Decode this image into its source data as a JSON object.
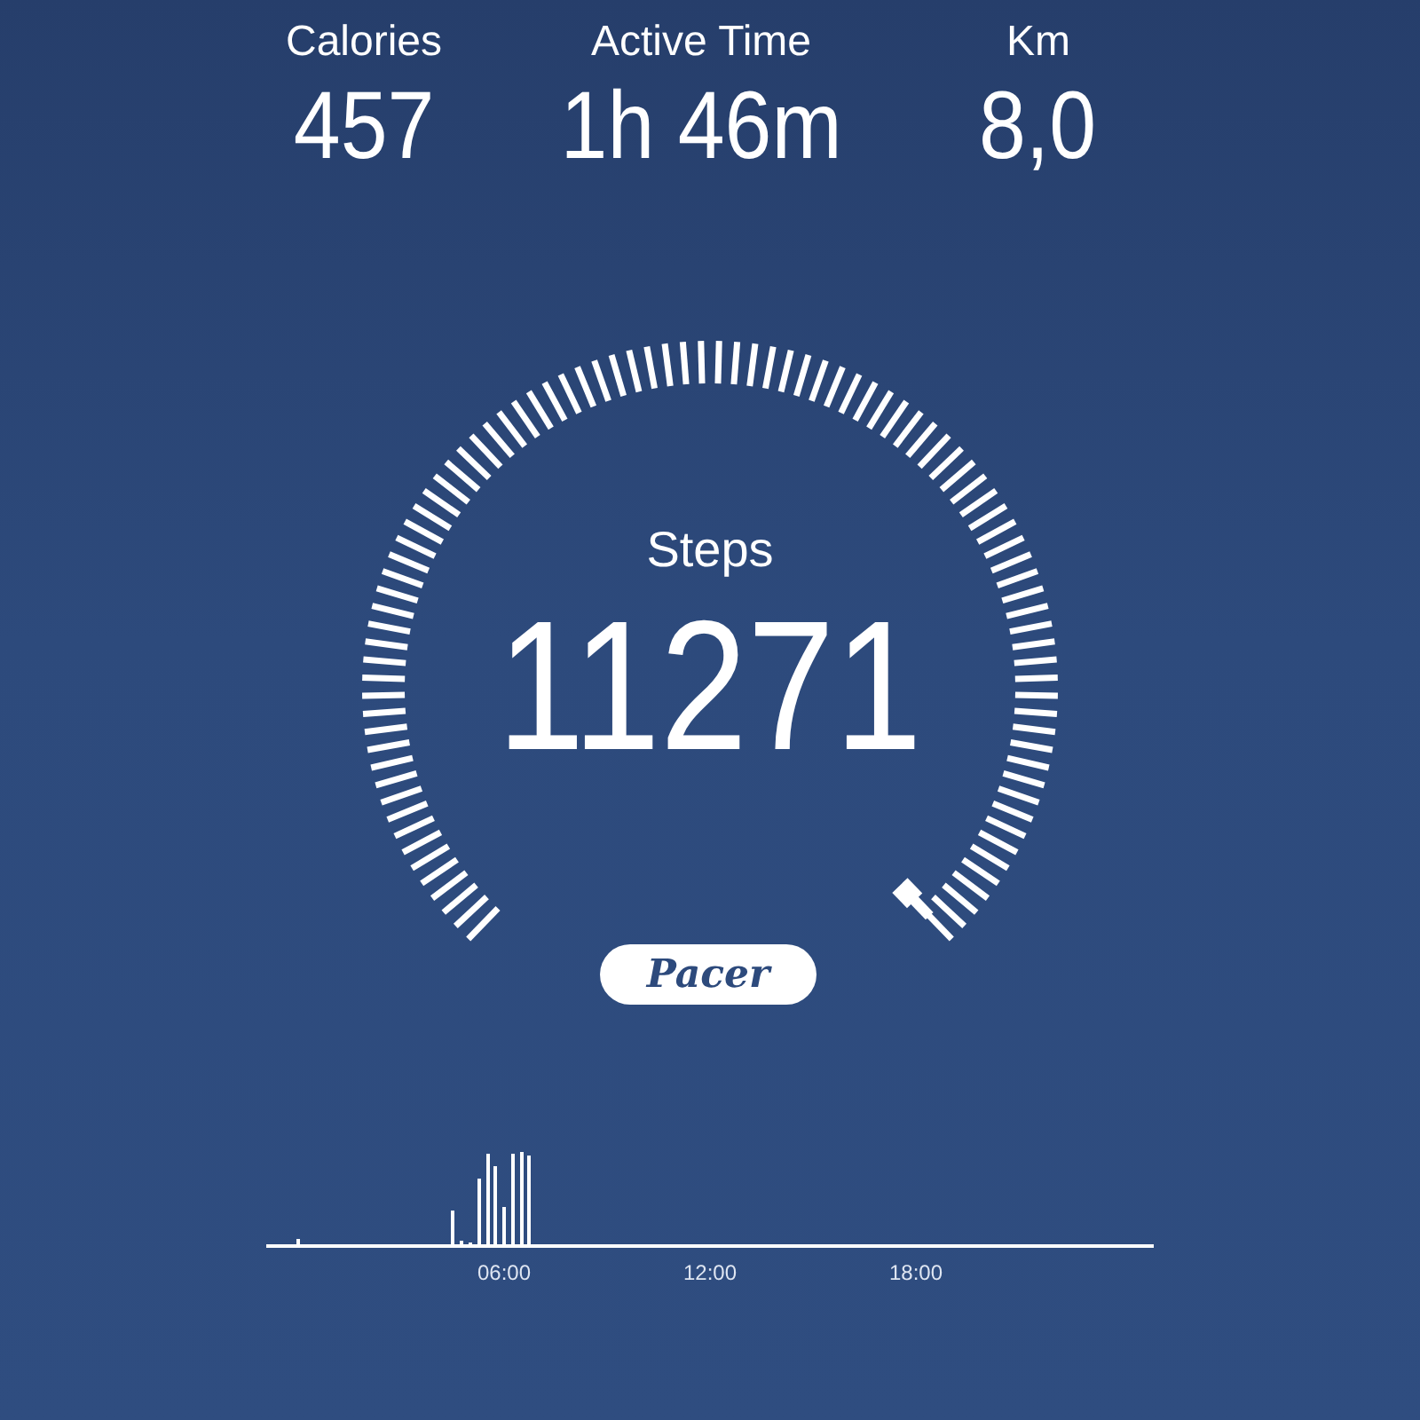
{
  "stats": [
    {
      "label": "Calories",
      "value": "457"
    },
    {
      "label": "Active Time",
      "value": "1h 46m"
    },
    {
      "label": "Km",
      "value": "8,0"
    }
  ],
  "gauge": {
    "label": "Steps",
    "value": "11271"
  },
  "logo": "Pacer",
  "activity_chart": {
    "x_labels": [
      "06:00",
      "12:00",
      "18:00"
    ]
  }
}
